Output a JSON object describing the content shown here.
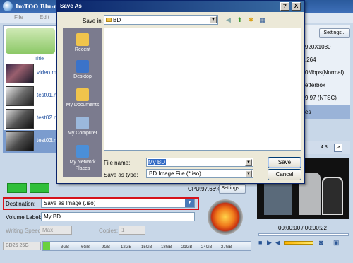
{
  "app": {
    "title": "ImTOO Blu-ray C",
    "menu": [
      "File",
      "Edit"
    ],
    "title_column": "Title",
    "files": [
      {
        "name": "video.mkv",
        "selected": false
      },
      {
        "name": "test01.mkv",
        "selected": false
      },
      {
        "name": "test02.mkv",
        "selected": false
      },
      {
        "name": "test03.mkv",
        "selected": true
      }
    ],
    "settings_top": "Settings...",
    "props": [
      "920X1080",
      ".264",
      "0Mbps(Normal)",
      "etterbox",
      "9.97 (NTSC)",
      "es"
    ],
    "cpu": "CPU:97.66%",
    "settings_bottom": "Settings...",
    "destination_label": "Destination:",
    "destination_value": "Save as Image (.iso)",
    "volume_label_label": "Volume Label:",
    "volume_label_value": "My BD",
    "writing_speed_label": "Writing Speed:",
    "writing_speed_value": "Max",
    "copies_label": "Copies:",
    "copies_value": "1",
    "disc_type": "BD25 25G",
    "capacity_ticks": [
      "3GB",
      "6GB",
      "9GB",
      "12GB",
      "15GB",
      "18GB",
      "21GB",
      "24GB",
      "27GB"
    ],
    "aspect_ratio": "4:3",
    "time": "00:00:00 / 00:00:22"
  },
  "dialog": {
    "title": "Save As",
    "help_btn": "?",
    "close_btn": "X",
    "save_in_label": "Save in:",
    "save_in_value": "BD",
    "places": [
      {
        "label": "Recent",
        "icon": "recent-icon",
        "color": "#f0c44c"
      },
      {
        "label": "Desktop",
        "icon": "desktop-icon",
        "color": "#3b73c9"
      },
      {
        "label": "My Documents",
        "icon": "my-documents-icon",
        "color": "#f0c44c"
      },
      {
        "label": "My Computer",
        "icon": "my-computer-icon",
        "color": "#9bb8dc"
      },
      {
        "label": "My Network Places",
        "icon": "network-icon",
        "color": "#4b8fd8"
      }
    ],
    "file_name_label": "File name:",
    "file_name_value": "My BD",
    "save_type_label": "Save as type:",
    "save_type_value": "BD Image File (*.iso)",
    "save_button": "Save",
    "cancel_button": "Cancel"
  },
  "colors": {
    "destination_highlight": "#d6121b",
    "dialog_title_bar": "#0a246a",
    "places_bar": "#7b7b8e"
  }
}
